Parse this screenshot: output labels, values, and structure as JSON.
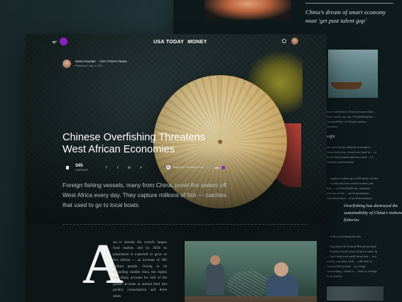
{
  "back_article": {
    "quote": "China's dream of smart economy must 'get past talent gap'",
    "text_1": "have travelled to Africa because their ... have nearly run out. 'Overfishing has ... sustainability of China's inshore fisheries.'",
    "heading": "sight",
    "text_2": "are notoriously difficult to monitor ... vessels are tiny, vessels are hard to ... of local and international laws and ... of fisheries enforcement.",
    "text_3": "... regulate waters up to 200 miles off the ... to national laws control waters just that, ... of Gold Fisheries, assistant director of the ... and Atmospheric Administration ... Law Enforcement.",
    "pullquote": "Overfishing has destroyed the sustainability of China's inshore fisheries",
    "text_4": "... without breaking the law.",
    "text_5": "... legislation in Guinea-Bissau has kept ... fishing vessels away from its coast. In ... have deployed small boats that ... few nearby countries such ... with fish in Guinea-Bissau and ... in a huge 'nonfeeding,' which is ... back or foreign to be traded."
  },
  "nav": {
    "logo": "USA TODAY",
    "section": "MONEY"
  },
  "byline": {
    "author": "Steve Kandan",
    "org": "USA TODAY News",
    "published": "Published 1 day 4, 2017"
  },
  "article": {
    "headline": "Chinese Overfishing Threatens West African Economies",
    "deck": "Foreign fishing vessels, many from China, prowl the waters off West Africa every day. They capture millions of fish — catches that used to go to local boats",
    "dropcap": "A",
    "body": "sia is already the world's largest food market, and by 2050 its population is expected to grow to five billion — an increase of 900 million people. Owing to its expanding middle class, the region will likely account for half of the global increase in animal beef and poultry consumption and three times"
  },
  "share": {
    "count": "345",
    "label": "SHAREMAP",
    "icons": [
      "f",
      "t",
      "in",
      "↗"
    ]
  },
  "audio": {
    "title": "Tough love: Too tough for my",
    "time": "11 min",
    "controls": "◀ ▶"
  },
  "colors": {
    "accent": "#8a1fc4",
    "card_bg": "#0e1516",
    "page_bg": "#1f3336"
  }
}
